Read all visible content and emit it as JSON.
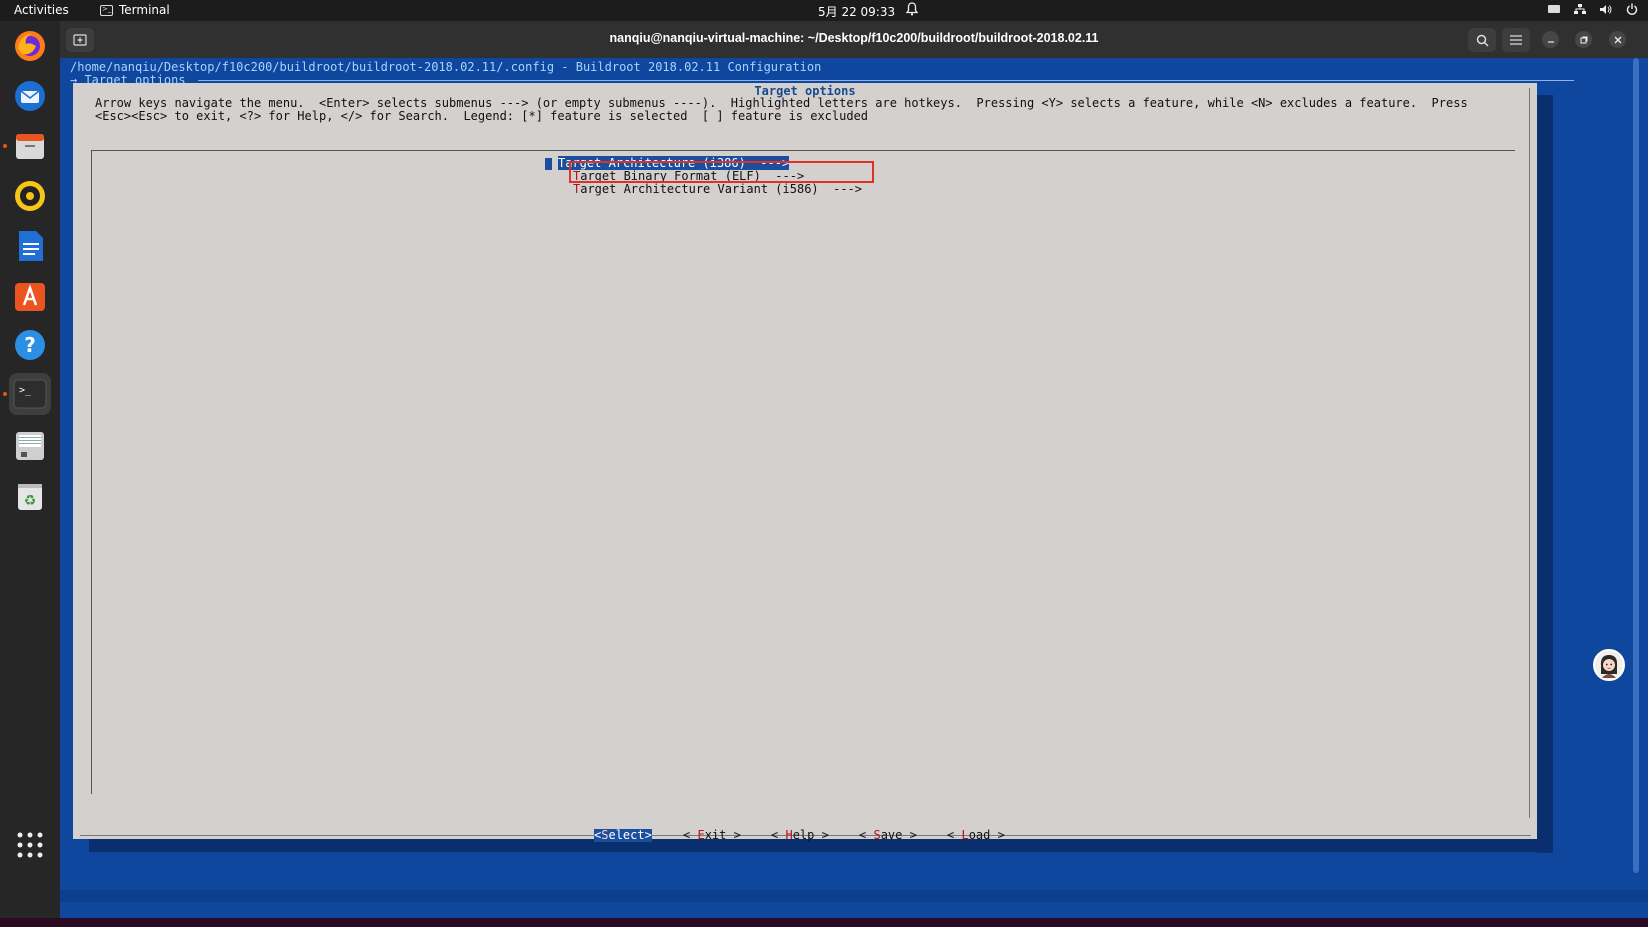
{
  "topbar": {
    "activities": "Activities",
    "app_name": "Terminal",
    "clock": "5月 22  09:33"
  },
  "dock": {
    "items": [
      {
        "name": "firefox-icon"
      },
      {
        "name": "thunderbird-icon"
      },
      {
        "name": "files-icon"
      },
      {
        "name": "rhythmbox-icon"
      },
      {
        "name": "writer-icon"
      },
      {
        "name": "app-center-icon"
      },
      {
        "name": "help-icon"
      },
      {
        "name": "terminal-icon"
      },
      {
        "name": "disk-icon"
      },
      {
        "name": "trash-icon"
      },
      {
        "name": "show-apps-icon"
      }
    ]
  },
  "window": {
    "title": "nanqiu@nanqiu-virtual-machine: ~/Desktop/f10c200/buildroot/buildroot-2018.02.11"
  },
  "terminal": {
    "path_line": "/home/nanqiu/Desktop/f10c200/buildroot/buildroot-2018.02.11/.config - Buildroot 2018.02.11 Configuration",
    "crumb": "→ Target options",
    "dialog_title": "Target options",
    "help_line1": "Arrow keys navigate the menu.  <Enter> selects submenus ---> (or empty submenus ----).  Highlighted letters are hotkeys.  Pressing <Y> selects a feature, while <N> excludes a feature.  Press",
    "help_line2": "<Esc><Esc> to exit, <?> for Help, </> for Search.  Legend: [*] feature is selected  [ ] feature is excluded",
    "menu": [
      {
        "hotkey": "T",
        "rest": "arget Architecture (i386)  --->",
        "selected": true
      },
      {
        "hotkey": "T",
        "rest": "arget Binary Format (ELF)  --->",
        "selected": false
      },
      {
        "hotkey": "T",
        "rest": "arget Architecture Variant (i586)  --->",
        "selected": false
      }
    ],
    "buttons": {
      "select_open": "<",
      "select_hk": "S",
      "select_rest": "elect>",
      "exit_pre": "< ",
      "exit_hk": "E",
      "exit_rest": "xit >",
      "help_pre": "< ",
      "help_hk": "H",
      "help_rest": "elp >",
      "save_pre": "< ",
      "save_hk": "S",
      "save_rest": "ave >",
      "load_pre": "< ",
      "load_hk": "L",
      "load_rest": "oad >"
    }
  },
  "colors": {
    "terminal_bg": "#10479e",
    "dialog_bg": "#d3d0cd",
    "highlight": "#1b4f9e",
    "hotkey": "#b9101b",
    "annotation_box": "#e0302a",
    "accent": "#e95420"
  }
}
